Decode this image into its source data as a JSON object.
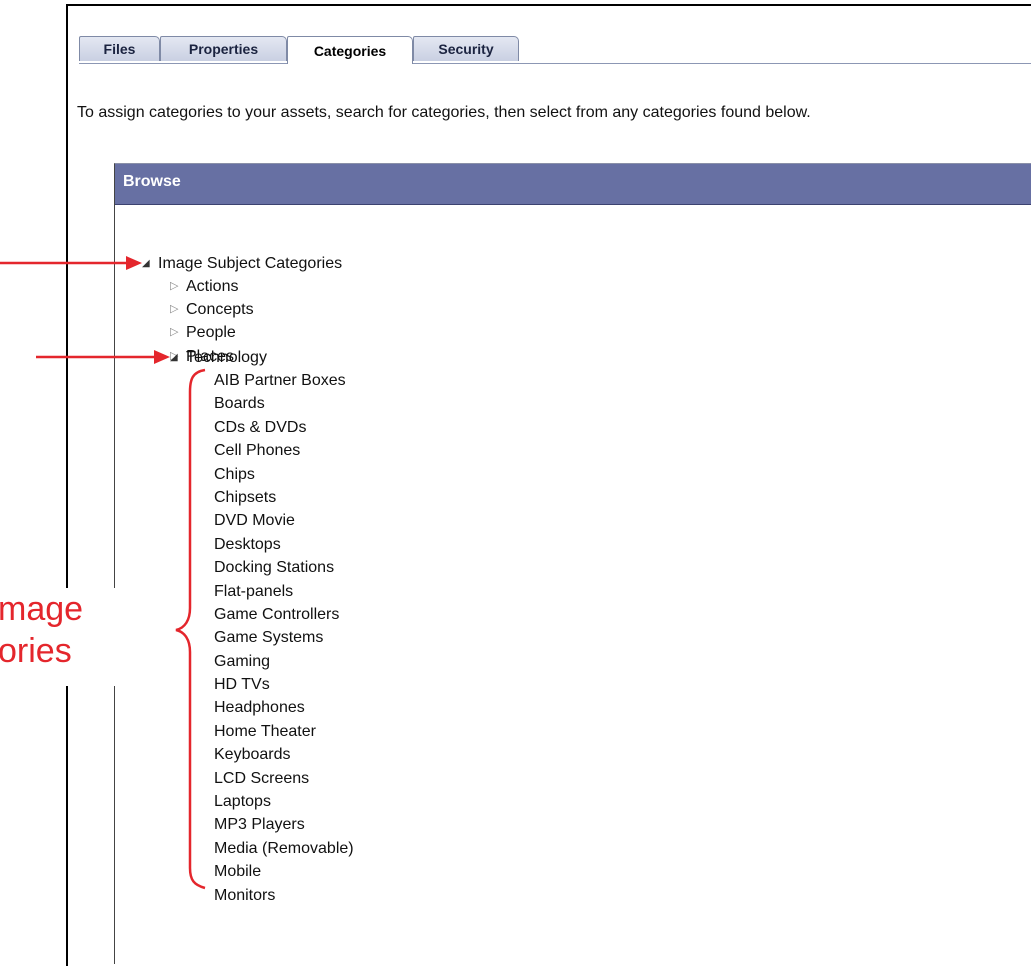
{
  "tabs": [
    {
      "label": "Files",
      "active": false
    },
    {
      "label": "Properties",
      "active": false
    },
    {
      "label": "Categories",
      "active": true
    },
    {
      "label": "Security",
      "active": false
    }
  ],
  "instructions": "To assign categories to your assets, search for categories, then select from any categories found below.",
  "browse": {
    "header": "Browse",
    "root": {
      "label": "Image Subject Categories",
      "expanded": true
    },
    "children": [
      {
        "label": "Actions",
        "expanded": false
      },
      {
        "label": "Concepts",
        "expanded": false
      },
      {
        "label": "People",
        "expanded": false
      },
      {
        "label": "Places",
        "expanded": false
      },
      {
        "label": "Technology",
        "expanded": true
      }
    ],
    "technology_items": [
      "AIB Partner Boxes",
      "Boards",
      "CDs & DVDs",
      "Cell Phones",
      "Chips",
      "Chipsets",
      "DVD Movie",
      "Desktops",
      "Docking Stations",
      "Flat-panels",
      "Game Controllers",
      "Game Systems",
      "Gaming",
      "HD TVs",
      "Headphones",
      "Home Theater",
      "Keyboards",
      "LCD Screens",
      "Laptops",
      "MP3 Players",
      "Media (Removable)",
      "Mobile",
      "Monitors"
    ]
  },
  "annotation": {
    "line1": "mage",
    "line2": "ories",
    "color": "#e4262c"
  },
  "icons": {
    "expanded": "triangle-down-icon",
    "collapsed": "triangle-right-icon"
  }
}
